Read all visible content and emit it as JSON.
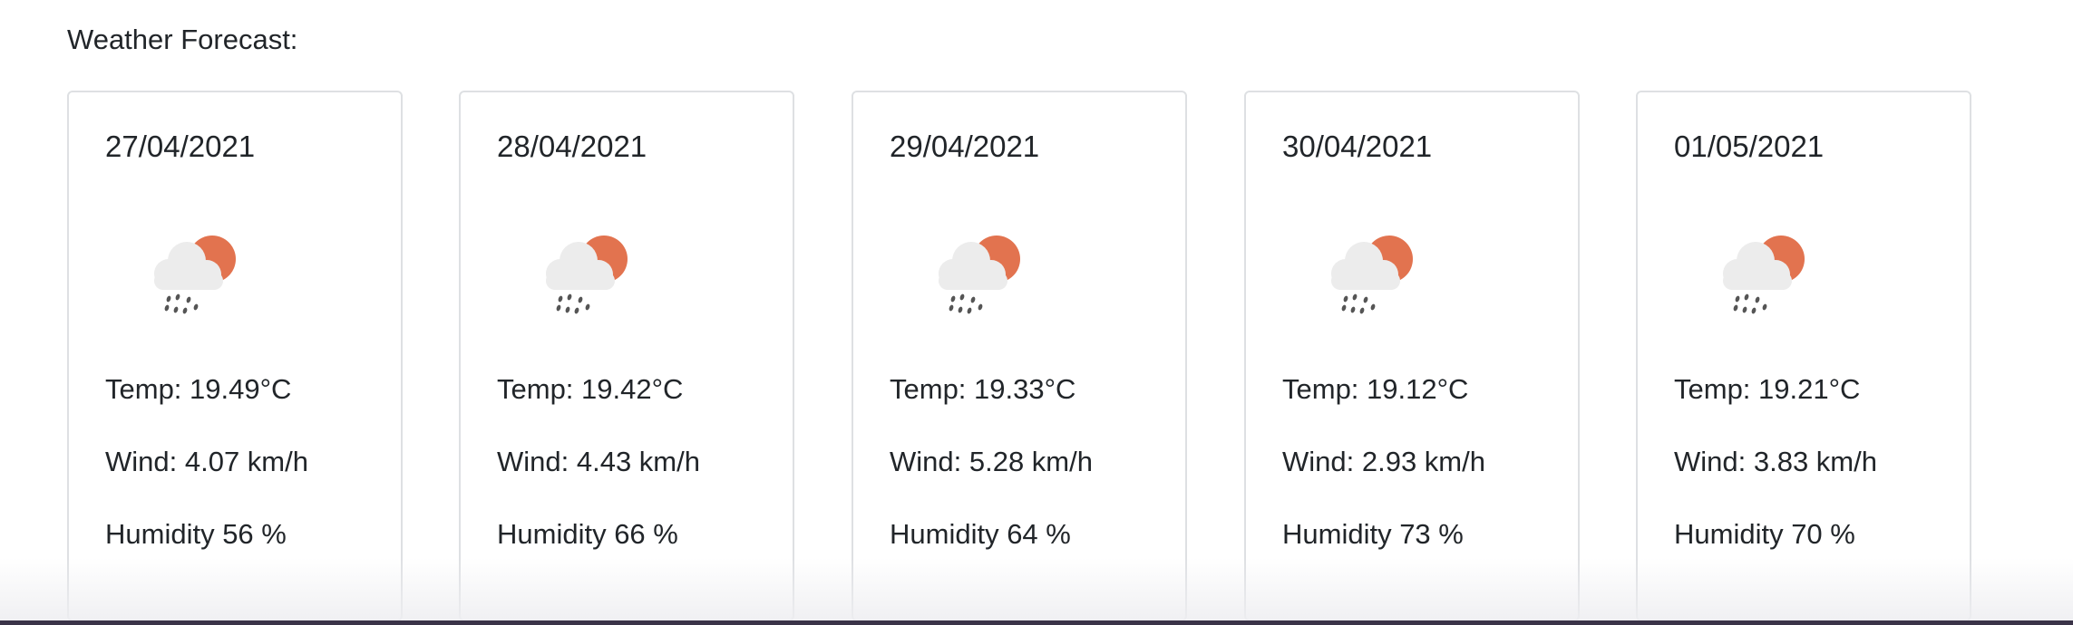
{
  "page": {
    "heading": "Weather Forecast:"
  },
  "forecast": [
    {
      "date": "27/04/2021",
      "temp": "Temp: 19.49°C",
      "wind": "Wind: 4.07 km/h",
      "humidity": "Humidity 56 %",
      "icon": "cloud-sun-rain-icon"
    },
    {
      "date": "28/04/2021",
      "temp": "Temp: 19.42°C",
      "wind": "Wind: 4.43 km/h",
      "humidity": "Humidity 66 %",
      "icon": "cloud-sun-rain-icon"
    },
    {
      "date": "29/04/2021",
      "temp": "Temp: 19.33°C",
      "wind": "Wind: 5.28 km/h",
      "humidity": "Humidity 64 %",
      "icon": "cloud-sun-rain-icon"
    },
    {
      "date": "30/04/2021",
      "temp": "Temp: 19.12°C",
      "wind": "Wind: 2.93 km/h",
      "humidity": "Humidity 73 %",
      "icon": "cloud-sun-rain-icon"
    },
    {
      "date": "01/05/2021",
      "temp": "Temp: 19.21°C",
      "wind": "Wind: 3.83 km/h",
      "humidity": "Humidity 70 %",
      "icon": "cloud-sun-rain-icon"
    }
  ],
  "colors": {
    "sun": "#e2734f",
    "cloud": "#ececec",
    "rain": "#555555",
    "card_border": "#dee0e3",
    "bottom_bar": "#3a3348"
  }
}
